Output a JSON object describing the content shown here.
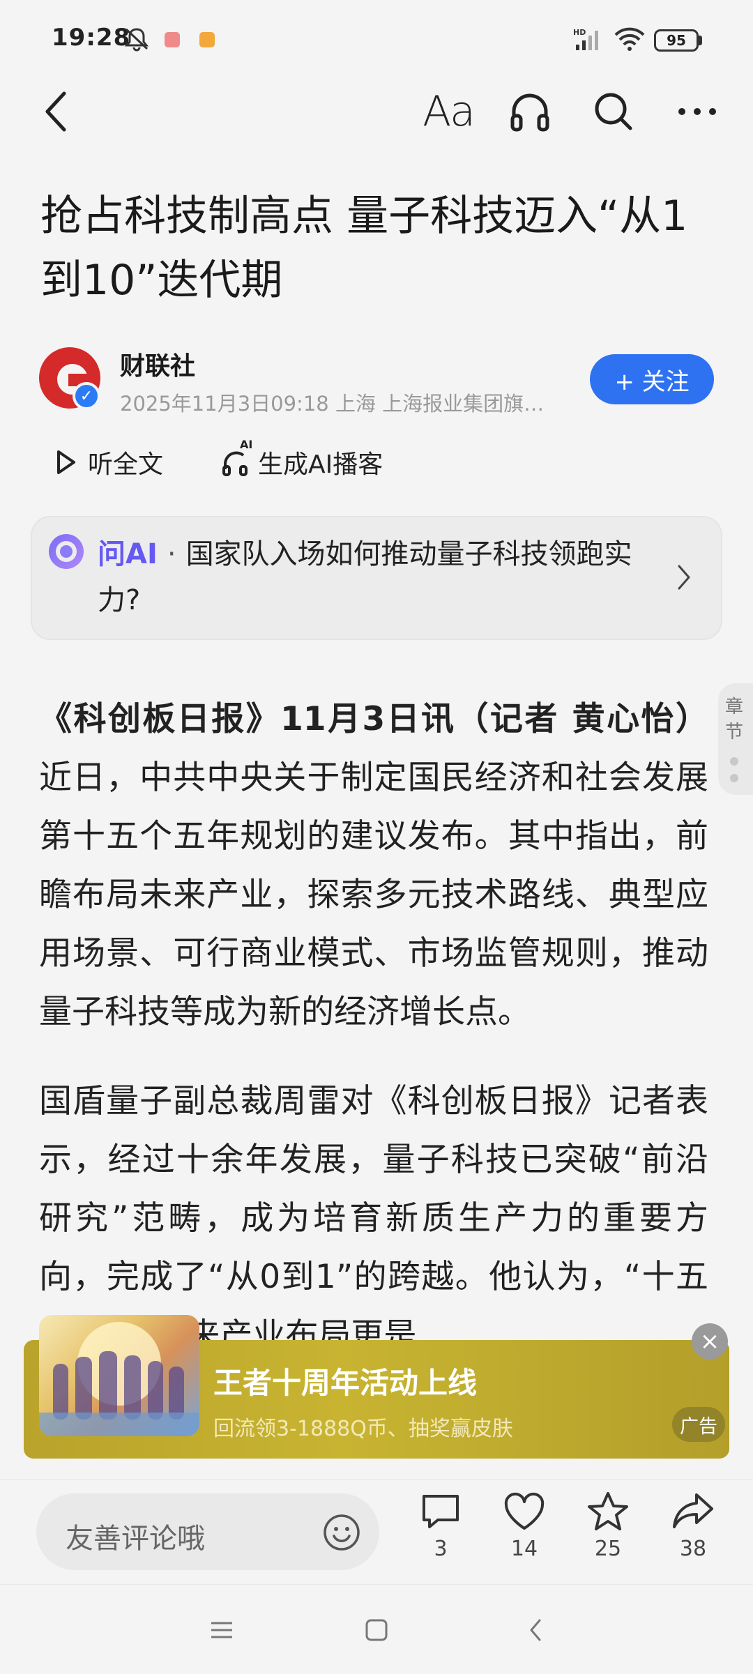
{
  "status_bar": {
    "time": "19:28",
    "battery": "95",
    "icons": [
      "mute-bell-icon",
      "app-notification-icon",
      "app-notification-icon",
      "hd-signal-icon",
      "wifi-icon",
      "battery-icon"
    ]
  },
  "nav": {
    "back_icon": "back-arrow-icon",
    "font_label": "Aa",
    "icons": [
      "headphones-icon",
      "search-icon",
      "more-icon"
    ]
  },
  "article": {
    "headline": "抢占科技制高点 量子科技迈入“从1到10”迭代期",
    "author": {
      "name": "财联社",
      "meta": "2025年11月3日09:18 上海 上海报业集团旗…",
      "follow_label": "+ 关注"
    },
    "listen": {
      "full_text_label": "听全文",
      "ai_podcast_label": "生成AI播客",
      "ai_badge": "AI"
    },
    "ask_ai": {
      "label": "问AI",
      "separator": "·",
      "question": "国家队入场如何推动量子科技领跑实力?"
    },
    "chapter_label": "章节",
    "p1_lead": "《科创板日报》11月3日讯（记者 黄心怡）",
    "p1_body": "近日，中共中央关于制定国民经济和社会发展第十五个五年规划的建议发布。其中指出，前瞻布局未来产业，探索多元技术路线、典型应用场景、可行商业模式、市场监管规则，推动量子科技等成为新的经济增长点。",
    "p2_body": "国盾量子副总裁周雷对《科创板日报》记者表示，经过十余年发展，量子科技已突破“前沿研究”范畴，成为培育新质生产力的重要方向，完成了“从0到1”的跨越。他认为，“十五五”规划未来产业布局更是"
  },
  "ad": {
    "title": "王者十周年活动上线",
    "subtitle": "回流领3-1888Q币、抽奖赢皮肤",
    "tag": "广告",
    "close": "×"
  },
  "bottom_bar": {
    "comment_placeholder": "友善评论哦",
    "comments": "3",
    "likes": "14",
    "favorites": "25",
    "shares": "38"
  },
  "colors": {
    "accent": "#2e72f2",
    "ai_purple": "#6658f2",
    "brand_red": "#d52a2a",
    "ad_gold": "#c8b431"
  }
}
